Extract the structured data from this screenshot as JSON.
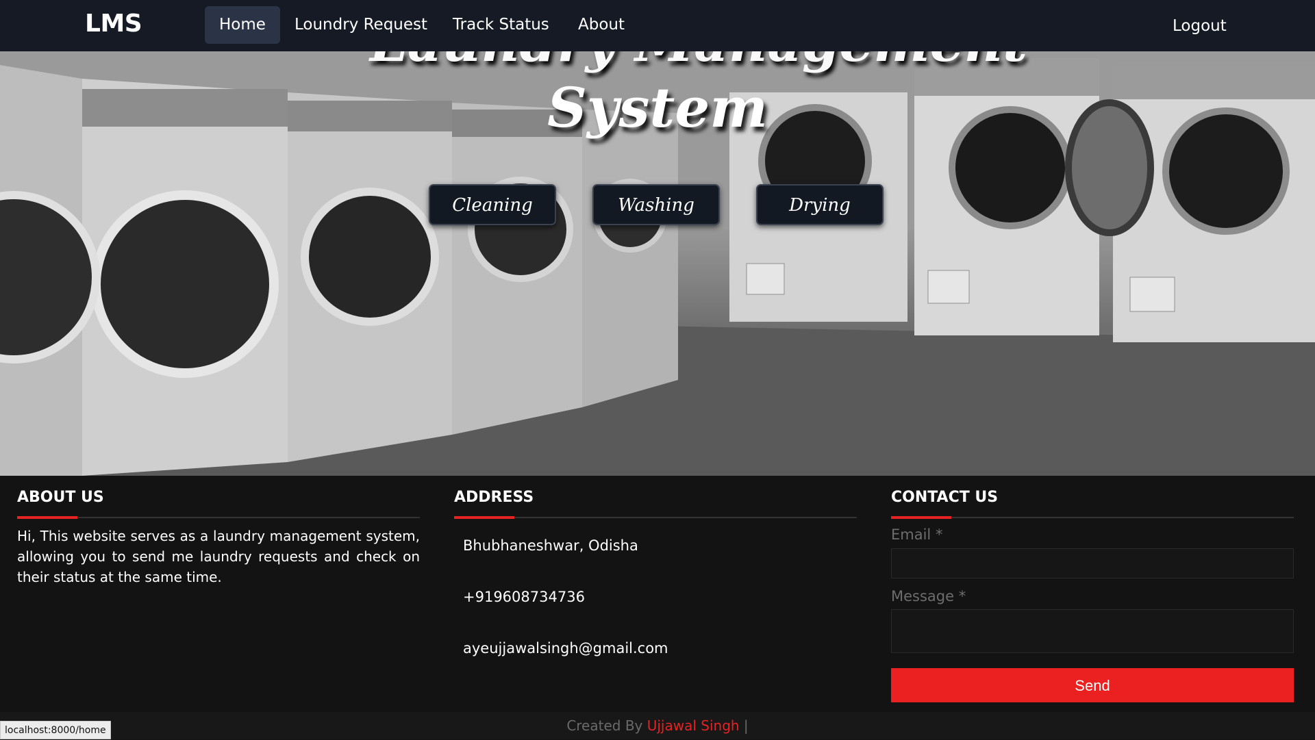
{
  "navbar": {
    "brand": "LMS",
    "items": [
      {
        "label": "Home",
        "active": true
      },
      {
        "label": "Loundry Request",
        "active": false
      },
      {
        "label": "Track Status",
        "active": false
      },
      {
        "label": "About",
        "active": false
      }
    ],
    "logout_label": "Logout"
  },
  "hero": {
    "title_top": "Laundry Management",
    "title": "System",
    "buttons": [
      "Cleaning",
      "Washing",
      "Drying"
    ]
  },
  "footer": {
    "about": {
      "heading": "ABOUT US",
      "text": "Hi, This website serves as a laundry management system, allowing you to send me laundry requests and check on their status at the same time."
    },
    "address": {
      "heading": "ADDRESS",
      "location": "Bhubhaneshwar, Odisha",
      "phone": "+919608734736",
      "email": "ayeujjawalsingh@gmail.com"
    },
    "contact": {
      "heading": "CONTACT US",
      "email_label": "Email *",
      "message_label": "Message *",
      "send_label": "Send"
    }
  },
  "credit": {
    "prefix": "Created By ",
    "author": "Ujjawal Singh",
    "separator": " |"
  },
  "status_bar": {
    "url": "localhost:8000/home"
  },
  "colors": {
    "accent": "#e62222",
    "navbar": "#151a25",
    "footer": "#131313"
  }
}
